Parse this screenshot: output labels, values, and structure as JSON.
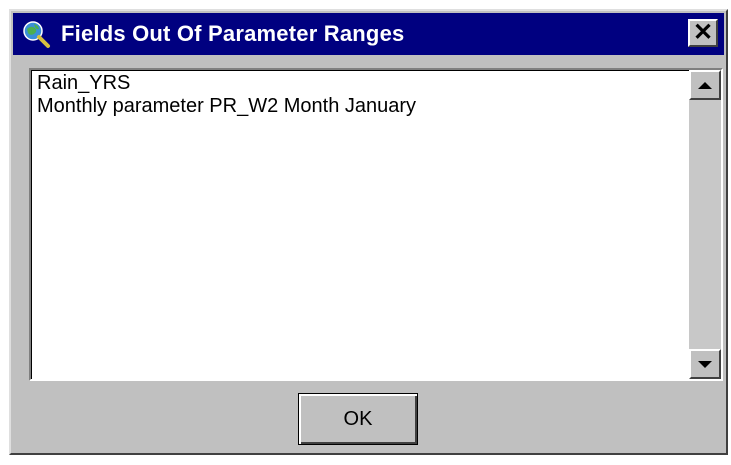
{
  "window": {
    "title": "Fields Out Of Parameter Ranges",
    "app_icon": "magnifier-globe-icon",
    "close_icon": "close-icon",
    "close_glyph": "✕"
  },
  "list": {
    "lines": [
      "Rain_YRS",
      "Monthly parameter PR_W2 Month January"
    ]
  },
  "scrollbar": {
    "up_icon": "arrow-up-icon",
    "down_icon": "arrow-down-icon"
  },
  "buttons": {
    "ok_label": "OK"
  },
  "colors": {
    "titlebar": "#000080",
    "face": "#c0c0c0"
  }
}
